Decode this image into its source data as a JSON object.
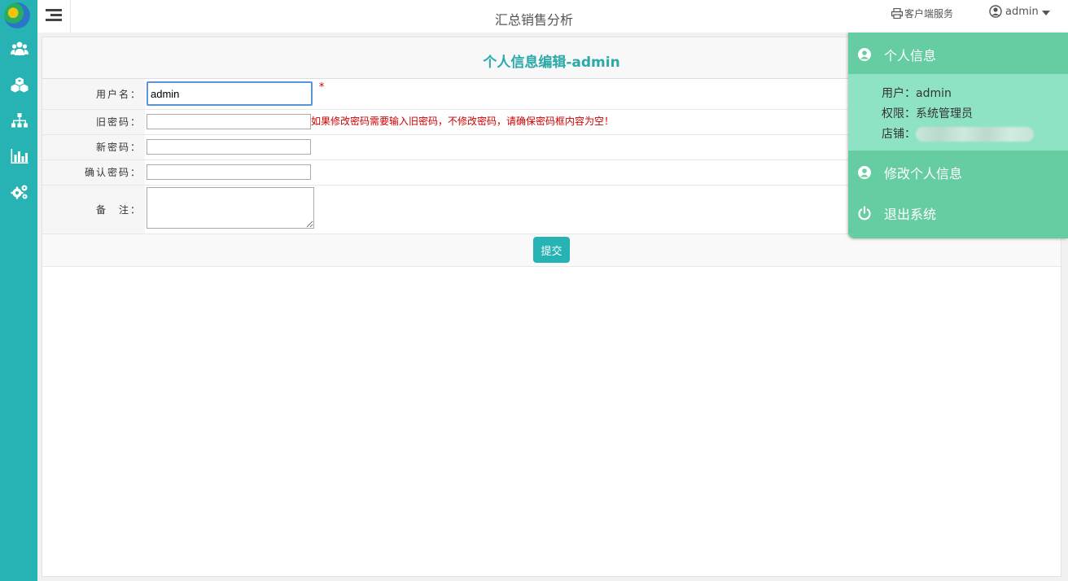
{
  "topbar": {
    "title": "汇总销售分析",
    "client_service": "客户端服务",
    "user": "admin"
  },
  "sidebar": {
    "items": [
      {
        "icon": "users-icon"
      },
      {
        "icon": "cubes-icon"
      },
      {
        "icon": "sitemap-icon"
      },
      {
        "icon": "bar-chart-icon"
      },
      {
        "icon": "gears-icon"
      }
    ]
  },
  "panel": {
    "title": "个人信息编辑-admin"
  },
  "form": {
    "username_label": "用户名：",
    "username_value": "admin",
    "required_mark": "*",
    "old_password_label": "旧密码：",
    "password_hint": "如果修改密码需要输入旧密码，不修改密码，请确保密码框内容为空！",
    "new_password_label": "新密码：",
    "confirm_password_label": "确认密码：",
    "remark_label": "备　注：",
    "submit_label": "提交"
  },
  "dropdown": {
    "personal_info": "个人信息",
    "user_label": "用户：",
    "user_value": "admin",
    "permission_label": "权限：",
    "permission_value": "系统管理员",
    "store_label": "店铺：",
    "edit_info": "修改个人信息",
    "logout": "退出系统"
  },
  "colors": {
    "accent": "#27b3b3",
    "dropdown_bg": "#66cca2",
    "dropdown_info_bg": "#8fe3c5",
    "hint_red": "#cc0000"
  }
}
